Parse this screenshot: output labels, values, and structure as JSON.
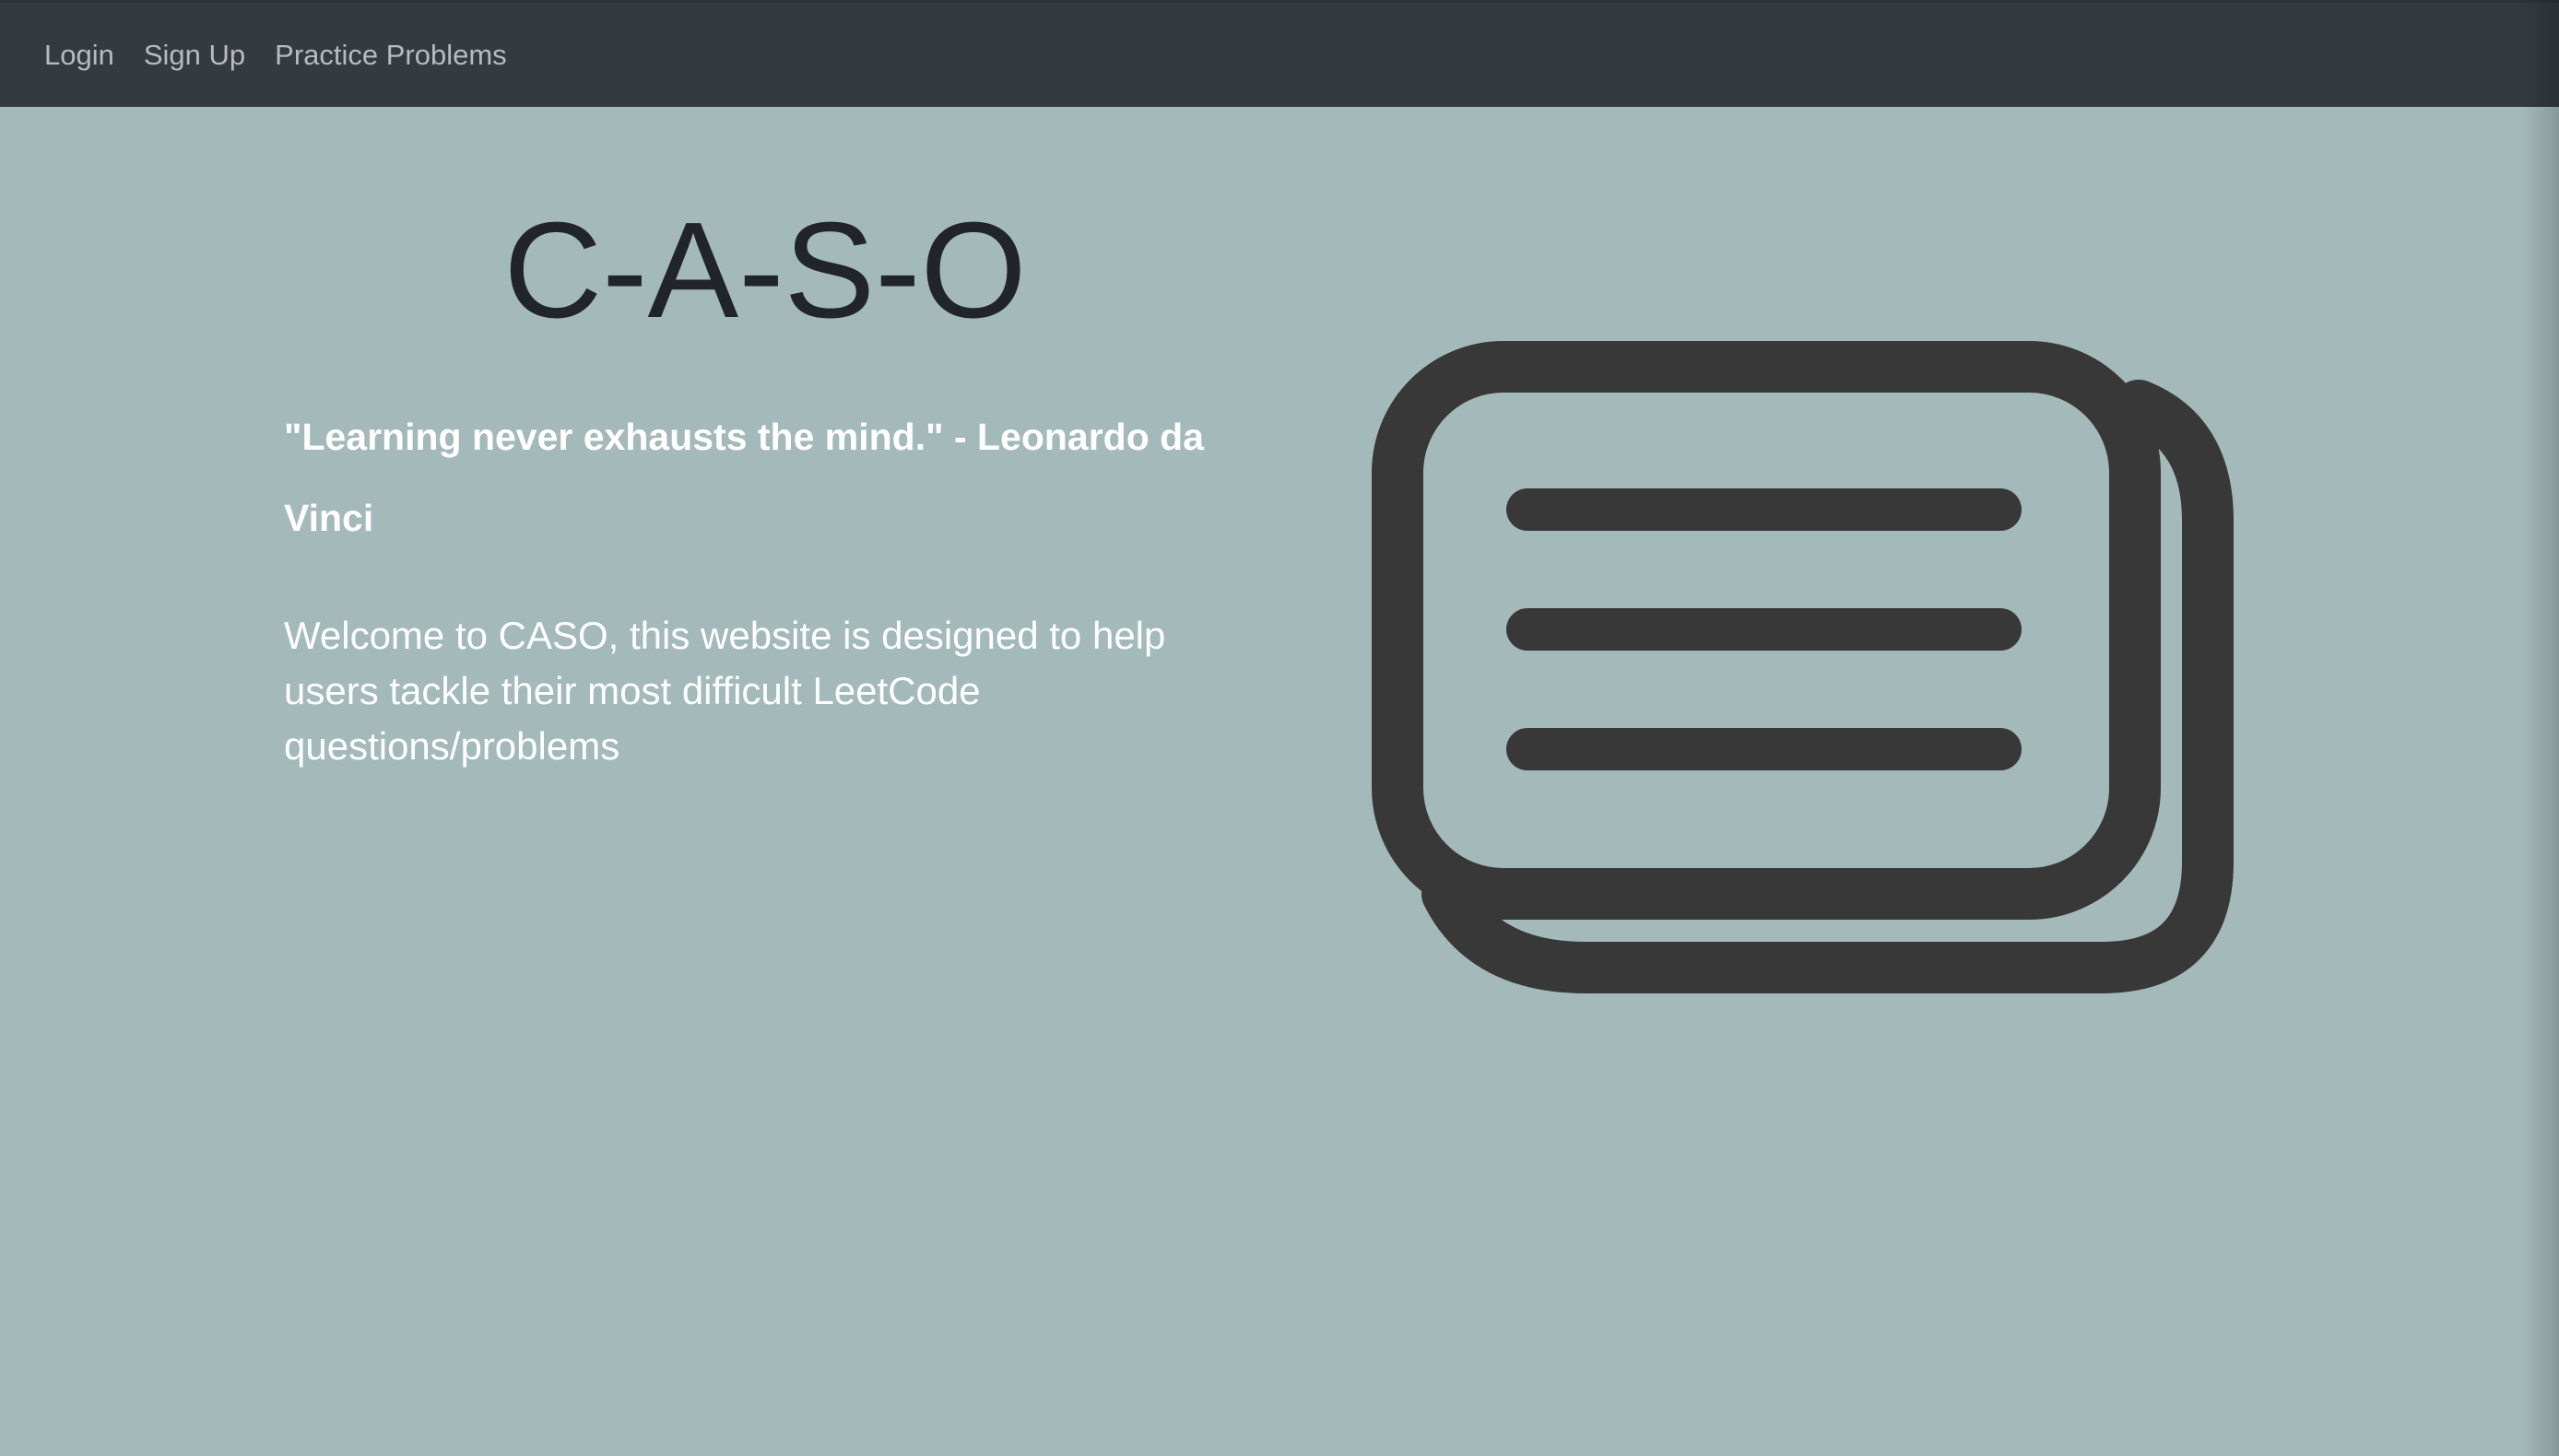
{
  "nav": {
    "items": [
      {
        "label": "Login"
      },
      {
        "label": "Sign Up"
      },
      {
        "label": "Practice Problems"
      }
    ]
  },
  "hero": {
    "title": "C-A-S-O",
    "quote": "\"Learning never exhausts the mind.\" - Leonardo da Vinci",
    "welcome": "Welcome to CASO, this website is designed to help users tackle their most difficult LeetCode questions/problems"
  },
  "illustration": {
    "icon": "stacked-cards-icon",
    "stroke_color": "#373837"
  },
  "colors": {
    "page_background": "#a4b9ba",
    "navbar_background": "#343a40",
    "nav_link": "#b7bbbf",
    "title_text": "#212529",
    "body_text": "#ffffff"
  }
}
